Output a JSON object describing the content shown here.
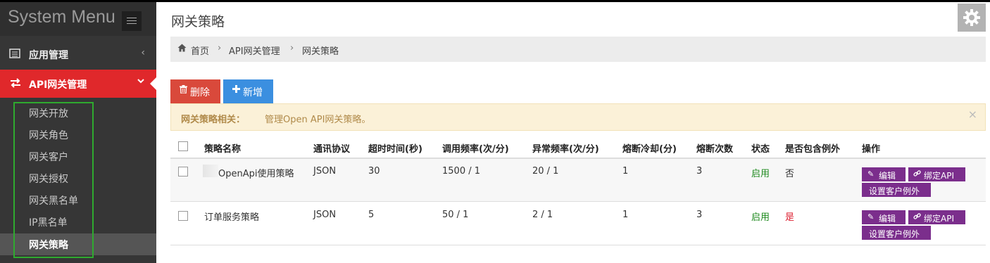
{
  "sidebar": {
    "brand": "System Menu",
    "menu": [
      {
        "label": "应用管理",
        "icon": "app-icon"
      },
      {
        "label": "API网关管理",
        "icon": "exchange-icon"
      }
    ],
    "submenu": [
      "网关开放",
      "网关角色",
      "网关客户",
      "网关授权",
      "网关黑名单",
      "IP黑名单",
      "网关策略"
    ],
    "active_sub": "网关策略"
  },
  "header": {
    "title": "网关策略"
  },
  "breadcrumb": [
    "首页",
    "API网关管理",
    "网关策略"
  ],
  "toolbar": {
    "delete_label": "删除",
    "add_label": "新增"
  },
  "alert": {
    "strong": "网关策略相关：",
    "text": "管理Open API网关策略。",
    "close": "×"
  },
  "table": {
    "columns": [
      "策略名称",
      "通讯协议",
      "超时时间(秒)",
      "调用频率(次/分)",
      "异常频率(次/分)",
      "熔断冷却(分)",
      "熔断次数",
      "状态",
      "是否包含例外",
      "操作"
    ],
    "rows": [
      {
        "name": "OpenApi使用策略",
        "protocol": "JSON",
        "timeout": "30",
        "rate": "1500 / 1",
        "error_rate": "20 / 1",
        "cooldown": "1",
        "breaks": "3",
        "status": "启用",
        "has_exception": "否"
      },
      {
        "name": "订单服务策略",
        "protocol": "JSON",
        "timeout": "5",
        "rate": "50 / 1",
        "error_rate": "2 / 1",
        "cooldown": "1",
        "breaks": "3",
        "status": "启用",
        "has_exception": "是"
      }
    ],
    "actions": {
      "edit": "编辑",
      "bind": "绑定API",
      "exception": "设置客户例外"
    }
  },
  "colors": {
    "sidebar_bg": "#363636",
    "active_menu": "#e0282b",
    "delete_btn": "#d9493b",
    "add_btn": "#3b8fe0",
    "action_btn": "#7b2e8c",
    "status_on": "#1e8a1e",
    "exception_yes": "#dd2233"
  }
}
